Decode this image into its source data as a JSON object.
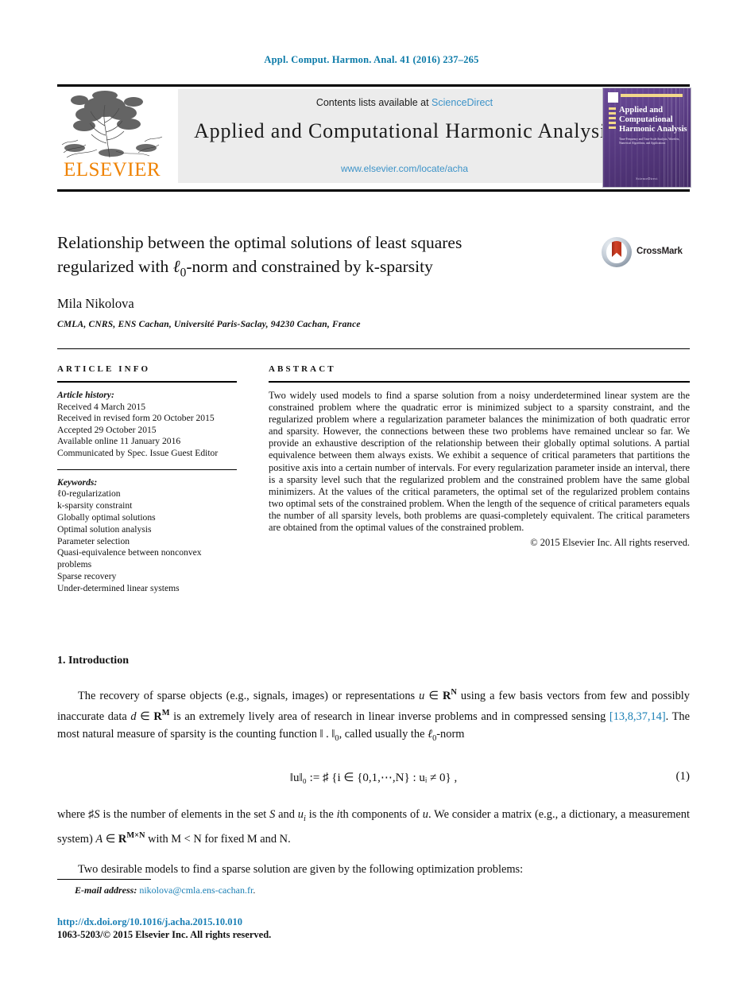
{
  "running_head": "Appl. Comput. Harmon. Anal. 41 (2016) 237–265",
  "masthead": {
    "elsevier_wordmark": "ELSEVIER",
    "contents_prefix": "Contents lists available at ",
    "sciencedirect": "ScienceDirect",
    "journal_name": "Applied and Computational Harmonic Analysis",
    "journal_url": "www.elsevier.com/locate/acha",
    "cover": {
      "title": "Applied and Computational Harmonic Analysis",
      "subtitle": "Time-Frequency and Time-Scale Analysis, Wavelets, Numerical Algorithms, and Applications",
      "footer": "ScienceDirect"
    }
  },
  "article": {
    "title": "Relationship between the optimal solutions of least squares regularized with ℓ0-norm and constrained by k-sparsity",
    "title_line1_a": "Relationship between the optimal solutions of least squares",
    "title_line2_a": "regularized with ",
    "title_line2_sym": "ℓ",
    "title_line2_sub": "0",
    "title_line2_b": "-norm and constrained by k-sparsity",
    "author": "Mila Nikolova",
    "affiliation": "CMLA, CNRS, ENS Cachan, Université Paris-Saclay, 94230 Cachan, France",
    "crossmark_label": "CrossMark"
  },
  "info": {
    "heading": "ARTICLE INFO",
    "history_label": "Article history:",
    "history": [
      "Received 4 March 2015",
      "Received in revised form 20 October 2015",
      "Accepted 29 October 2015",
      "Available online 11 January 2016",
      "Communicated by Spec. Issue Guest Editor"
    ],
    "keywords_label": "Keywords:",
    "keywords": [
      "ℓ0-regularization",
      "k-sparsity constraint",
      "Globally optimal solutions",
      "Optimal solution analysis",
      "Parameter selection",
      "Quasi-equivalence between nonconvex problems",
      "Sparse recovery",
      "Under-determined linear systems"
    ]
  },
  "abstract": {
    "heading": "ABSTRACT",
    "text": "Two widely used models to find a sparse solution from a noisy underdetermined linear system are the constrained problem where the quadratic error is minimized subject to a sparsity constraint, and the regularized problem where a regularization parameter balances the minimization of both quadratic error and sparsity. However, the connections between these two problems have remained unclear so far. We provide an exhaustive description of the relationship between their globally optimal solutions. A partial equivalence between them always exists. We exhibit a sequence of critical parameters that partitions the positive axis into a certain number of intervals. For every regularization parameter inside an interval, there is a sparsity level such that the regularized problem and the constrained problem have the same global minimizers. At the values of the critical parameters, the optimal set of the regularized problem contains two optimal sets of the constrained problem. When the length of the sequence of critical parameters equals the number of all sparsity levels, both problems are quasi-completely equivalent. The critical parameters are obtained from the optimal values of the constrained problem.",
    "copyright": "© 2015 Elsevier Inc. All rights reserved."
  },
  "body": {
    "section_title": "1. Introduction",
    "paragraph1_part1": "The recovery of sparse objects (e.g., signals, images) or representations ",
    "paragraph1_u": "u",
    "paragraph1_in": " ∈ ",
    "paragraph1_RN": "R",
    "paragraph1_N": "N",
    "paragraph1_part2": " using a few basis vectors from few and possibly inaccurate data ",
    "paragraph1_d": "d",
    "paragraph1_RM": "R",
    "paragraph1_M": "M",
    "paragraph1_part3": " is an extremely lively area of research in linear inverse problems and in compressed sensing ",
    "paragraph1_cite": "[13,8,37,14]",
    "paragraph1_part4": ". The most natural measure of sparsity is the counting function ‖ . ‖",
    "paragraph1_sub0": "0",
    "paragraph1_part5": ", called usually the ",
    "paragraph1_ell": "ℓ",
    "paragraph1_part6": "-norm",
    "equation1": "‖u‖₀ := ♯ {i ∈ {0,1,⋯,N} : uᵢ ≠ 0} ,",
    "equation1_number": "(1)",
    "paragraph2_part1": "where ♯",
    "paragraph2_S": "S",
    "paragraph2_part2": " is the number of elements in the set ",
    "paragraph2_S2": "S",
    "paragraph2_part3": " and ",
    "paragraph2_ui": "u",
    "paragraph2_i": "i",
    "paragraph2_part4": " is the ",
    "paragraph2_ith": "i",
    "paragraph2_part5": "th components of ",
    "paragraph2_u": "u",
    "paragraph2_part6": ". We consider a matrix (e.g., a dictionary, a measurement system) ",
    "paragraph2_A": "A",
    "paragraph2_part7": " ∈ ",
    "paragraph2_R": "R",
    "paragraph2_MN": "M×N",
    "paragraph2_part8": " with M < N for fixed M and N.",
    "paragraph3": "Two desirable models to find a sparse solution are given by the following optimization problems:"
  },
  "footer": {
    "email_label": "E-mail address:",
    "email": "nikolova@cmla.ens-cachan.fr",
    "email_period": ".",
    "doi": "http://dx.doi.org/10.1016/j.acha.2015.10.010",
    "issn": "1063-5203/© 2015 Elsevier Inc. All rights reserved."
  },
  "colors": {
    "link": "#1a7fb5",
    "sciencedirect": "#3d93c8",
    "elsevier_orange": "#ef8200",
    "cover_purple": "#5b3f86"
  }
}
